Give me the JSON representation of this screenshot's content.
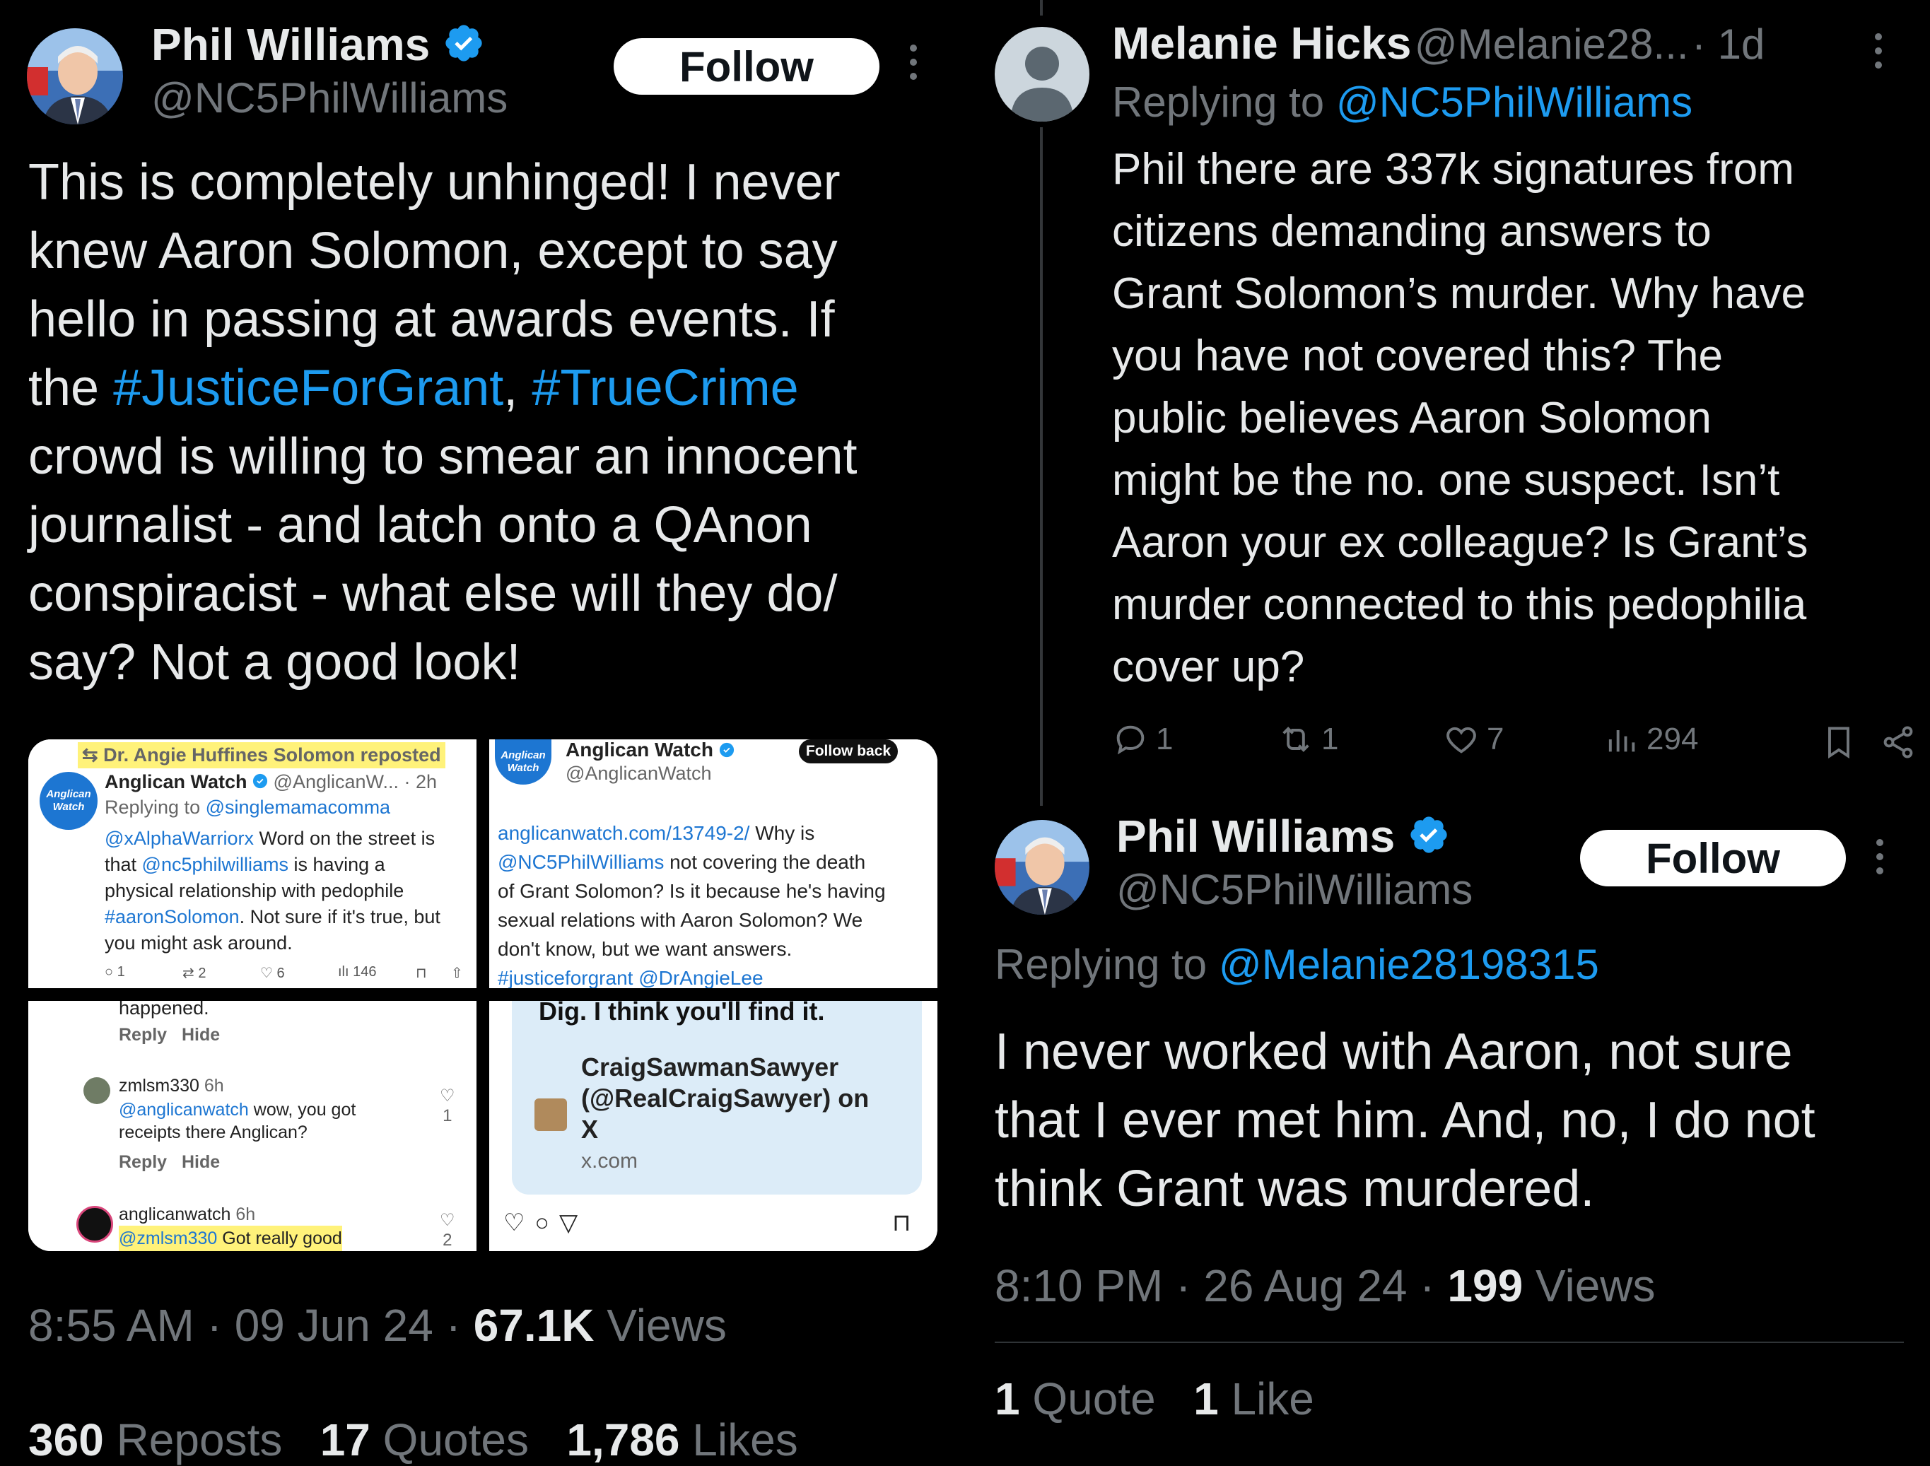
{
  "left": {
    "author": {
      "name": "Phil Williams",
      "handle": "@NC5PhilWilliams"
    },
    "follow_label": "Follow",
    "more": "⋮",
    "body": {
      "line1": "This is completely unhinged! I never",
      "line2": "knew Aaron Solomon, except to say",
      "line3": "hello in passing at awards events. If",
      "line4_pre": "the ",
      "tag1": "#JusticeForGrant",
      "comma": ", ",
      "tag2": "#TrueCrime",
      "line5": "crowd is willing to smear an innocent",
      "line6": "journalist - and latch onto a QAnon",
      "line7": "conspiracist - what else will they do/",
      "line8": "say? Not a good look!"
    },
    "meta": {
      "time": "8:55 AM",
      "sep": "·",
      "date": "09 Jun 24",
      "views_count": "67.1K",
      "views_label": "Views"
    },
    "engagement": {
      "reposts_count": "360",
      "reposts_label": "Reposts",
      "quotes_count": "17",
      "quotes_label": "Quotes",
      "likes_count": "1,786",
      "likes_label": "Likes"
    },
    "img1": {
      "repost_text": "Dr. Angie Huffines Solomon reposted",
      "avatar_text": "Anglican Watch",
      "name": "Anglican Watch",
      "handle_time": "@AnglicanW... · 2h",
      "replying_pre": "Replying to ",
      "replying_handle": "@singlemamacomma",
      "mention1": "@xAlphaWarriorx",
      "text1": " Word on the street is",
      "text2_pre": "that ",
      "mention2": "@nc5philwilliams",
      "text2_post": " is having a",
      "text3": "physical relationship with pedophile",
      "tag": "#aaronSolomon",
      "text4_post": ". Not sure if it's true, but",
      "text5": "you might ask around.",
      "replies": "1",
      "reposts": "2",
      "likes": "6",
      "views": "146"
    },
    "img2": {
      "avatar_text": "Anglican Watch",
      "name": "Anglican Watch",
      "handle": "@AnglicanWatch",
      "follow_back": "Follow back",
      "link": "anglicanwatch.com/13749-2/",
      "t1_post": " Why is",
      "mention": "@NC5PhilWilliams",
      "t2_post": " not covering the death",
      "t3": "of Grant Solomon? Is it because he's having",
      "t4": "sexual relations with Aaron Solomon? We",
      "t5": "don't know, but we want answers.",
      "t6": "#justiceforgrant @DrAngieLee"
    },
    "img3": {
      "happened": "happened.",
      "reply": "Reply",
      "hide": "Hide",
      "user1": "zmlsm330",
      "time1": "6h",
      "mention1": "@anglicanwatch",
      "text1a": " wow, you got",
      "text1b": "receipts there Anglican?",
      "likes1": "1",
      "user2": "anglicanwatch",
      "time2": "6h",
      "mention2": "@zmlsm330",
      "text2": " Got really good",
      "likes2": "2"
    },
    "img4": {
      "dig": "Dig. I think you'll find it.",
      "card1": "CraigSawmanSawyer",
      "card2": "(@RealCraigSawyer) on",
      "card3": "X",
      "domain": "x.com"
    }
  },
  "right": {
    "reply1": {
      "name": "Melanie Hicks",
      "handle": "@Melanie28...",
      "time": "· 1d",
      "more": "⋮",
      "replying_pre": "Replying to ",
      "replying_handle": "@NC5PhilWilliams",
      "lines": [
        "Phil there are 337k signatures from",
        "citizens demanding answers to",
        "Grant Solomon’s murder. Why have",
        "you have not covered this? The",
        "public believes Aaron Solomon",
        "might be the no. one suspect. Isn’t",
        "Aaron your ex colleague? Is Grant’s",
        "murder connected to this pedophilia",
        "cover up?"
      ],
      "replies": "1",
      "reposts": "1",
      "likes": "7",
      "views": "294"
    },
    "reply2": {
      "name": "Phil Williams",
      "handle": "@NC5PhilWilliams",
      "follow_label": "Follow",
      "more": "⋮",
      "replying_pre": "Replying to ",
      "replying_handle": "@Melanie28198315",
      "lines": [
        "I never worked with Aaron, not sure",
        "that I ever met him. And, no, I do not",
        "think Grant was murdered."
      ],
      "time": "8:10 PM",
      "sep": "·",
      "date": "26 Aug 24",
      "views_count": "199",
      "views_label": "Views",
      "quotes_count": "1",
      "quotes_label": "Quote",
      "likes_count": "1",
      "likes_label": "Like"
    }
  },
  "colors": {
    "bg": "#000000",
    "text": "#e7e9ea",
    "muted": "#71767b",
    "link": "#1d9bf0",
    "verified": "#1d9bf0",
    "highlight": "#fff27a"
  }
}
